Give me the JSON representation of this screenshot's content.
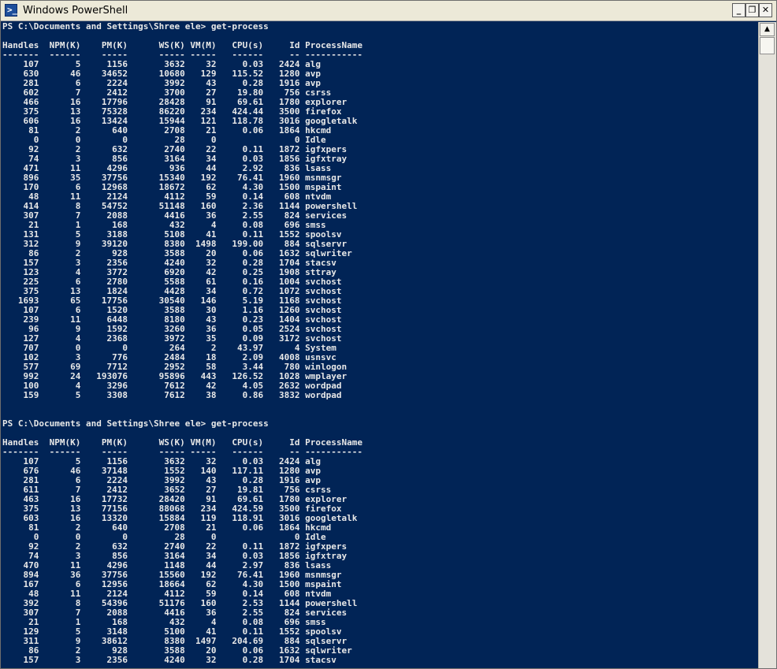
{
  "window": {
    "title": "Windows PowerShell",
    "icon": "powershell-icon",
    "minimize_label": "_",
    "maximize_label": "❐",
    "close_label": "✕"
  },
  "scrollbar": {
    "up_arrow": "▲"
  },
  "console": {
    "lines": [
      "PS C:\\Documents and Settings\\Shree ele> get-process",
      "",
      "Handles  NPM(K)    PM(K)      WS(K) VM(M)   CPU(s)     Id ProcessName",
      "-------  ------    -----      ----- -----   ------     -- -----------",
      "    107       5     1156       3632    32     0.03   2424 alg",
      "    630      46    34652      10680   129   115.52   1280 avp",
      "    281       6     2224       3992    43     0.28   1916 avp",
      "    602       7     2412       3700    27    19.80    756 csrss",
      "    466      16    17796      28428    91    69.61   1780 explorer",
      "    375      13    75328      86220   234   424.44   3500 firefox",
      "    606      16    13424      15944   121   118.78   3016 googletalk",
      "     81       2      640       2708    21     0.06   1864 hkcmd",
      "      0       0        0         28     0               0 Idle",
      "     92       2      632       2740    22     0.11   1872 igfxpers",
      "     74       3      856       3164    34     0.03   1856 igfxtray",
      "    471      11     4296        936    44     2.92    836 lsass",
      "    896      35    37756      15340   192    76.41   1960 msnmsgr",
      "    170       6    12968      18672    62     4.30   1500 mspaint",
      "     48      11     2124       4112    59     0.14    608 ntvdm",
      "    414       8    54752      51148   160     2.36   1144 powershell",
      "    307       7     2088       4416    36     2.55    824 services",
      "     21       1      168        432     4     0.08    696 smss",
      "    131       5     3188       5108    41     0.11   1552 spoolsv",
      "    312       9    39120       8380  1498   199.00    884 sqlservr",
      "     86       2      928       3588    20     0.06   1632 sqlwriter",
      "    157       3     2356       4240    32     0.28   1704 stacsv",
      "    123       4     3772       6920    42     0.25   1908 sttray",
      "    225       6     2780       5588    61     0.16   1004 svchost",
      "    375      13     1824       4428    34     0.72   1072 svchost",
      "   1693      65    17756      30540   146     5.19   1168 svchost",
      "    107       6     1520       3588    30     1.16   1260 svchost",
      "    239      11     6448       8180    43     0.23   1404 svchost",
      "     96       9     1592       3260    36     0.05   2524 svchost",
      "    127       4     2368       3972    35     0.09   3172 svchost",
      "    707       0        0        264     2    43.97      4 System",
      "    102       3      776       2484    18     2.09   4008 usnsvc",
      "    577      69     7712       2952    58     3.44    780 winlogon",
      "    992      24   193076      95896   443   126.52   1028 wmplayer",
      "    100       4     3296       7612    42     4.05   2632 wordpad",
      "    159       5     3308       7612    38     0.86   3832 wordpad",
      "",
      "",
      "PS C:\\Documents and Settings\\Shree ele> get-process",
      "",
      "Handles  NPM(K)    PM(K)      WS(K) VM(M)   CPU(s)     Id ProcessName",
      "-------  ------    -----      ----- -----   ------     -- -----------",
      "    107       5     1156       3632    32     0.03   2424 alg",
      "    676      46    37148       1552   140   117.11   1280 avp",
      "    281       6     2224       3992    43     0.28   1916 avp",
      "    611       7     2412       3652    27    19.81    756 csrss",
      "    463      16    17732      28420    91    69.61   1780 explorer",
      "    375      13    77156      88068   234   424.59   3500 firefox",
      "    603      16    13320      15884   119   118.91   3016 googletalk",
      "     81       2      640       2708    21     0.06   1864 hkcmd",
      "      0       0        0         28     0               0 Idle",
      "     92       2      632       2740    22     0.11   1872 igfxpers",
      "     74       3      856       3164    34     0.03   1856 igfxtray",
      "    470      11     4296       1148    44     2.97    836 lsass",
      "    894      36    37756      15560   192    76.41   1960 msnmsgr",
      "    167       6    12956      18664    62     4.30   1500 mspaint",
      "     48      11     2124       4112    59     0.14    608 ntvdm",
      "    392       8    54396      51176   160     2.53   1144 powershell",
      "    307       7     2088       4416    36     2.55    824 services",
      "     21       1      168        432     4     0.08    696 smss",
      "    129       5     3148       5100    41     0.11   1552 spoolsv",
      "    311       9    38612       8380  1497   204.69    884 sqlservr",
      "     86       2      928       3588    20     0.06   1632 sqlwriter",
      "    157       3     2356       4240    32     0.28   1704 stacsv"
    ]
  }
}
